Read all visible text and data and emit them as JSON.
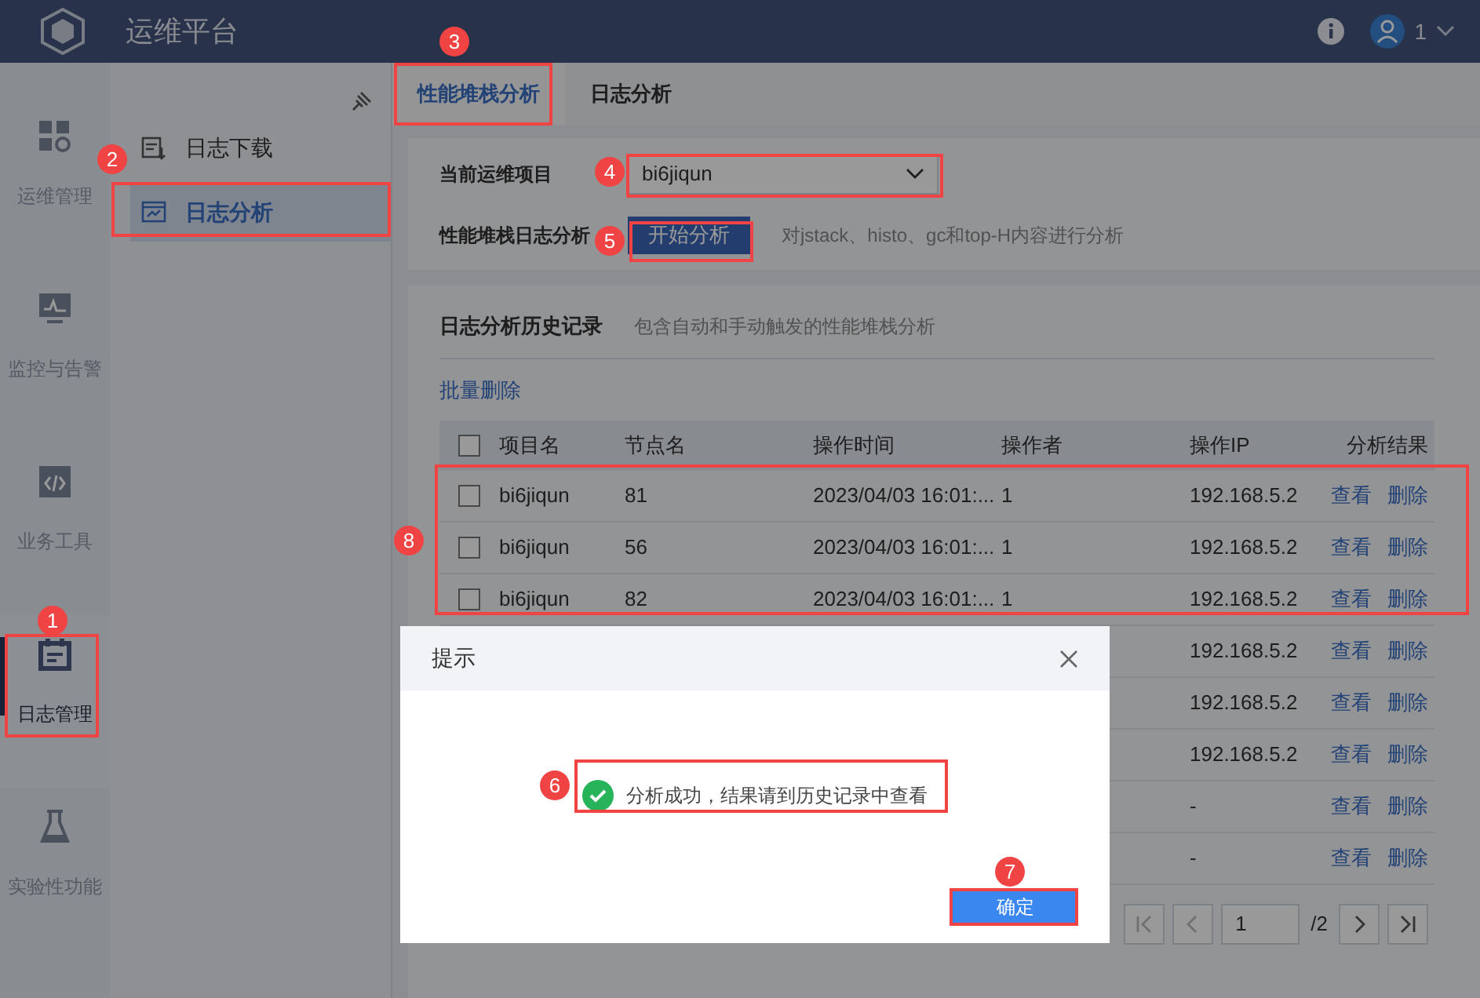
{
  "header": {
    "title": "运维平台",
    "user": "1"
  },
  "rail": [
    {
      "label": "运维管理",
      "selected": false
    },
    {
      "label": "监控与告警",
      "selected": false
    },
    {
      "label": "业务工具",
      "selected": false
    },
    {
      "label": "日志管理",
      "selected": true
    },
    {
      "label": "实验性功能",
      "selected": false
    }
  ],
  "subnav": [
    {
      "label": "日志下载",
      "selected": false
    },
    {
      "label": "日志分析",
      "selected": true
    }
  ],
  "tabs": [
    {
      "label": "性能堆栈分析",
      "selected": true
    },
    {
      "label": "日志分析",
      "selected": false
    }
  ],
  "form": {
    "project_label": "当前运维项目",
    "project_value": "bi6jiqun",
    "analysis_label": "性能堆栈日志分析",
    "analysis_button": "开始分析",
    "analysis_hint": "对jstack、histo、gc和top-H内容进行分析"
  },
  "history": {
    "title": "日志分析历史记录",
    "subtitle": "包含自动和手动触发的性能堆栈分析",
    "batch_delete": "批量删除",
    "columns": [
      "项目名",
      "节点名",
      "操作时间",
      "操作者",
      "操作IP",
      "分析结果"
    ],
    "select_all_checked": false,
    "rows": [
      {
        "project": "bi6jiqun",
        "node": "81",
        "time": "2023/04/03 16:01:...",
        "operator": "1",
        "ip": "192.168.5.2",
        "view": "查看",
        "delete": "删除",
        "checked": false
      },
      {
        "project": "bi6jiqun",
        "node": "56",
        "time": "2023/04/03 16:01:...",
        "operator": "1",
        "ip": "192.168.5.2",
        "view": "查看",
        "delete": "删除",
        "checked": false
      },
      {
        "project": "bi6jiqun",
        "node": "82",
        "time": "2023/04/03 16:01:...",
        "operator": "1",
        "ip": "192.168.5.2",
        "view": "查看",
        "delete": "删除",
        "checked": false
      },
      {
        "ip": "192.168.5.2",
        "view": "查看",
        "delete": "删除"
      },
      {
        "ip": "192.168.5.2",
        "view": "查看",
        "delete": "删除"
      },
      {
        "ip": "192.168.5.2",
        "view": "查看",
        "delete": "删除"
      },
      {
        "ip": "-",
        "view": "查看",
        "delete": "删除"
      },
      {
        "ip": "-",
        "view": "查看",
        "delete": "删除"
      }
    ],
    "pagination": {
      "page": "1",
      "total": "/2"
    }
  },
  "dialog": {
    "title": "提示",
    "message": "分析成功，结果请到历史记录中查看",
    "confirm": "确定"
  },
  "callouts": [
    "1",
    "2",
    "3",
    "4",
    "5",
    "6",
    "7",
    "8"
  ]
}
